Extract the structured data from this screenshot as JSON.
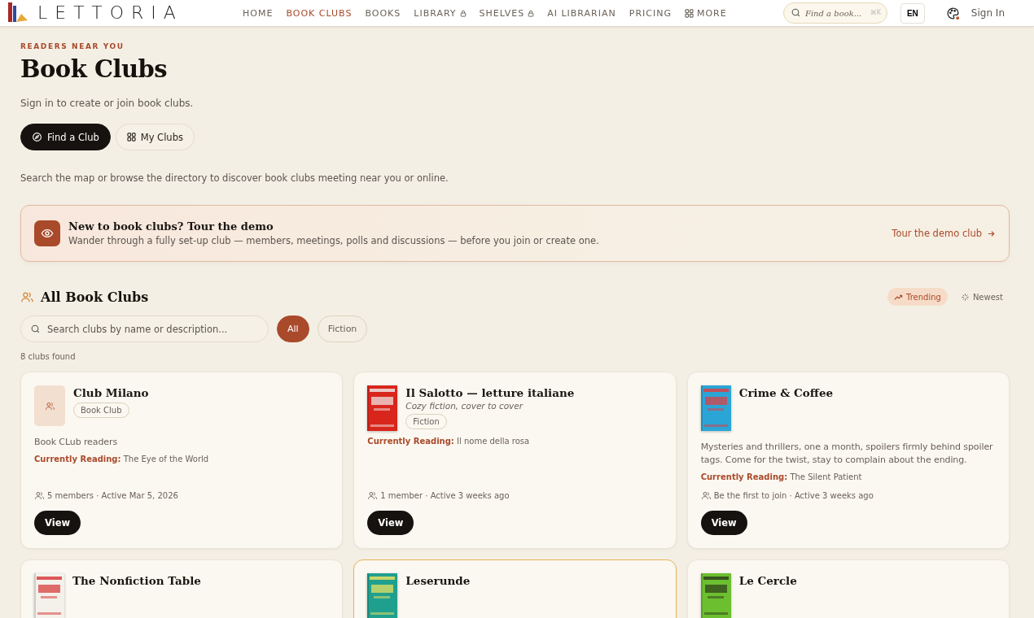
{
  "header": {
    "logo": "LETTORIA",
    "nav": [
      {
        "label": "HOME",
        "selected": false,
        "kind": "plain"
      },
      {
        "label": "BOOK CLUBS",
        "selected": true,
        "kind": "plain"
      },
      {
        "label": "BOOKS",
        "selected": false,
        "kind": "plain"
      },
      {
        "label": "LIBRARY",
        "selected": false,
        "kind": "locked"
      },
      {
        "label": "SHELVES",
        "selected": false,
        "kind": "locked"
      },
      {
        "label": "AI LIBRARIAN",
        "selected": false,
        "kind": "plain"
      },
      {
        "label": "PRICING",
        "selected": false,
        "kind": "plain"
      },
      {
        "label": "MORE",
        "selected": false,
        "kind": "grid"
      }
    ],
    "search": {
      "placeholder": "Find a book...",
      "shortcut": "⌘K"
    },
    "language": "EN",
    "sign_in": "Sign In"
  },
  "eyebrow": "READERS NEAR YOU",
  "title": "Book Clubs",
  "subtitle": "Sign in to create or join book clubs.",
  "mode_tabs": [
    {
      "label": "Find a Club",
      "selected": true,
      "kind": "compass"
    },
    {
      "label": "My Clubs",
      "selected": false,
      "kind": "grid"
    }
  ],
  "intro": "Search the map or browse the directory to discover book clubs meeting near you or online.",
  "banner": {
    "title": "New to book clubs? Tour the demo",
    "text": "Wander through a fully set-up club — members, meetings, polls and discussions — before you join or create one.",
    "link": "Tour the demo club"
  },
  "section": {
    "title": "All Book Clubs",
    "sort": [
      {
        "label": "Trending",
        "selected": true,
        "kind": "trend"
      },
      {
        "label": "Newest",
        "selected": false,
        "kind": "sparkle"
      }
    ],
    "search": {
      "placeholder": "Search clubs by name or description..."
    },
    "filters": [
      {
        "label": "All",
        "selected": true
      },
      {
        "label": "Fiction",
        "selected": false
      }
    ],
    "count": "8 clubs found"
  },
  "clubs": [
    {
      "name": "Club Milano",
      "kind": "icon",
      "featured": false,
      "tag": "Book Club",
      "description": "Book CLub readers",
      "reading_label": "Currently Reading:",
      "reading": "The Eye of the World",
      "meta": "5 members · Active Mar 5, 2026",
      "action": "View"
    },
    {
      "name": "Il Salotto — letture italiane",
      "kind": "cover",
      "featured": false,
      "tagline": "Cozy fiction, cover to cover",
      "tag": "Fiction",
      "reading_label": "Currently Reading:",
      "reading": "Il nome della rosa",
      "meta": "1 member · Active 3 weeks ago",
      "action": "View"
    },
    {
      "name": "Crime & Coffee",
      "kind": "cover",
      "featured": false,
      "description": "Mysteries and thrillers, one a month, spoilers firmly behind spoiler tags. Come for the twist, stay to complain about the ending.",
      "reading_label": "Currently Reading:",
      "reading": "The Silent Patient",
      "meta": "Be the first to join · Active 3 weeks ago",
      "action": "View"
    },
    {
      "name": "The Nonfiction Table",
      "kind": "cover",
      "featured": false
    },
    {
      "name": "Leserunde",
      "kind": "cover",
      "featured": true
    },
    {
      "name": "Le Cercle",
      "kind": "cover",
      "featured": false
    }
  ]
}
